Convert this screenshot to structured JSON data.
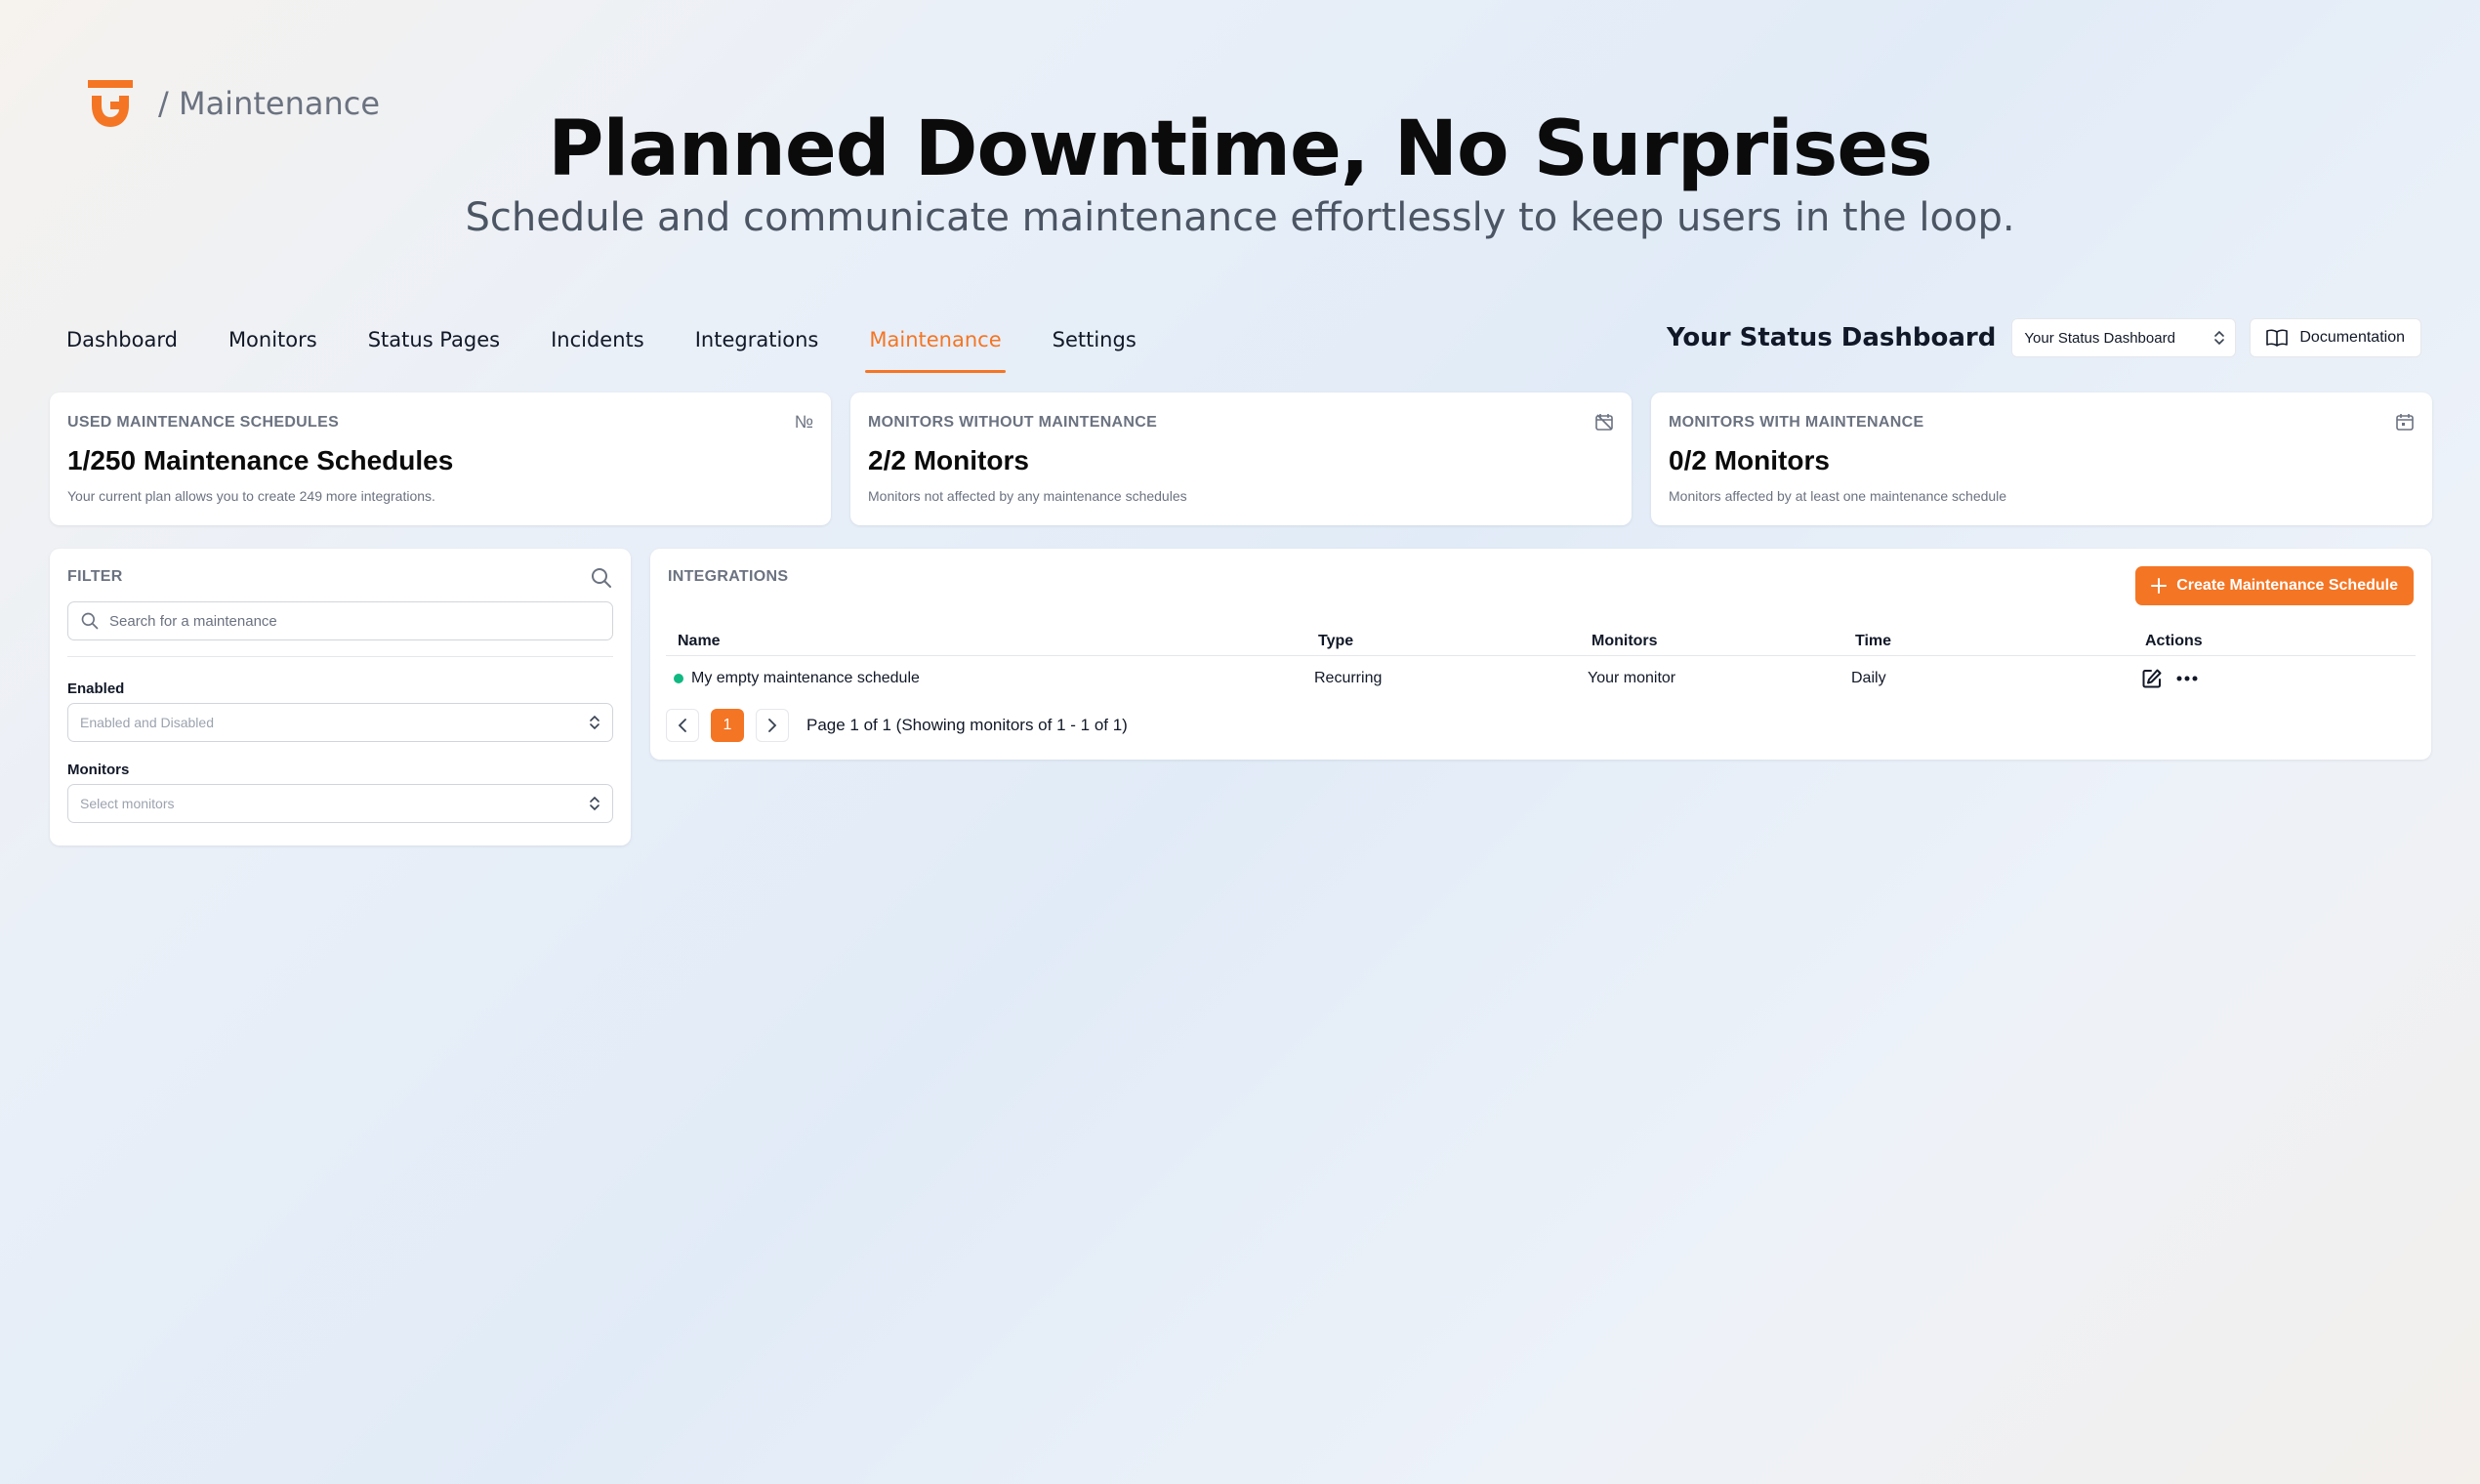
{
  "header": {
    "breadcrumb": "/ Maintenance",
    "title": "Planned Downtime, No Surprises",
    "subtitle": "Schedule and communicate maintenance effortlessly to keep users in the loop."
  },
  "nav": {
    "items": [
      "Dashboard",
      "Monitors",
      "Status Pages",
      "Incidents",
      "Integrations",
      "Maintenance",
      "Settings"
    ],
    "active": "Maintenance",
    "org_label": "Your Status Dashboard",
    "org_select": "Your Status Dashboard",
    "docs_label": "Documentation"
  },
  "stats": [
    {
      "label": "USED MAINTENANCE SCHEDULES",
      "value": "1/250 Maintenance Schedules",
      "note": "Your current plan allows you to create 249 more integrations.",
      "icon": "numero-icon"
    },
    {
      "label": "MONITORS WITHOUT MAINTENANCE",
      "value": "2/2 Monitors",
      "note": "Monitors not affected by any maintenance schedules",
      "icon": "calendar-off-icon"
    },
    {
      "label": "MONITORS WITH MAINTENANCE",
      "value": "0/2 Monitors",
      "note": "Monitors affected by at least one maintenance schedule",
      "icon": "calendar-icon"
    }
  ],
  "filter": {
    "title": "FILTER",
    "search_placeholder": "Search for a maintenance",
    "enabled_label": "Enabled",
    "enabled_value": "Enabled and Disabled",
    "monitors_label": "Monitors",
    "monitors_placeholder": "Select monitors"
  },
  "integrations": {
    "title": "INTEGRATIONS",
    "create_label": "Create Maintenance Schedule",
    "columns": [
      "Name",
      "Type",
      "Monitors",
      "Time",
      "Actions"
    ],
    "rows": [
      {
        "name": "My empty maintenance schedule",
        "type": "Recurring",
        "monitors": "Your monitor",
        "time": "Daily",
        "status_color": "#10b981"
      }
    ],
    "page_number": "1",
    "page_text": "Page 1 of 1 (Showing monitors of 1 - 1 of 1)"
  },
  "colors": {
    "accent": "#f47524",
    "status_ok": "#10b981"
  }
}
